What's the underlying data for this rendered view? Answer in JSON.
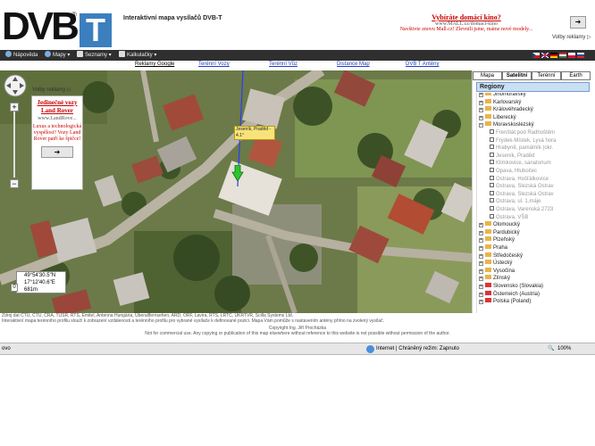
{
  "header": {
    "logo_text": "DVB",
    "logo_mark": "T",
    "logo_reg": "®",
    "app_title": "Interaktivní mapa vysílačů DVB-T",
    "promo": {
      "headline": "Vybíráte domácí kino?",
      "url": "www.MALL.cz/domaci-kino",
      "text": "Navštivte znovu Mall.cz! Zlevnili jsme, máme nové modely...",
      "arrow": "➔",
      "label": "Volby reklamy ▷"
    }
  },
  "menubar": {
    "items": [
      "Nápověda",
      "Mapy ▾",
      "Seznamy ▾",
      "Kalkulačky ▾"
    ]
  },
  "toplinks": [
    "Reklamy Google",
    "Terénní Vozy",
    "Terénní Vůz",
    "Distance Map",
    "DVB T Antény"
  ],
  "map": {
    "ad_label": "Volby reklamy ▷",
    "ad": {
      "title": "Jedinečné vozy Land Rover",
      "url": "www.LandRove...",
      "body": "Luxus a technologická vyspělost? Vozy Land Rover patří ke špičce!",
      "arrow": "➔"
    },
    "marker_label": "Jeseník, Praděd - 4.1°",
    "coords": {
      "lat": "49°54'30.5\"N",
      "lon": "17°12'40.6\"E",
      "alt": "681m"
    },
    "zoom_value": "0"
  },
  "panel": {
    "map_types": [
      "Mapa",
      "Satelitní",
      "Terénní",
      "Earth"
    ],
    "regions_title": "Regiony",
    "regions": [
      {
        "label": "Jihomoravský",
        "kind": "region"
      },
      {
        "label": "Karlovarský",
        "kind": "region"
      },
      {
        "label": "Královéhradecký",
        "kind": "region"
      },
      {
        "label": "Liberecký",
        "kind": "region"
      },
      {
        "label": "Moravskoslezský",
        "kind": "region"
      },
      {
        "label": "Frenštát pod Radhoštěm",
        "kind": "sub"
      },
      {
        "label": "Frýdek-Místek, Lysá hora",
        "kind": "sub"
      },
      {
        "label": "Hrabyně, památník (okr.",
        "kind": "sub"
      },
      {
        "label": "Jeseník, Praděd",
        "kind": "sub"
      },
      {
        "label": "Klimkovice, sanatorium",
        "kind": "sub"
      },
      {
        "label": "Opava, Hlubočec",
        "kind": "sub"
      },
      {
        "label": "Ostrava, Hošťálkovice",
        "kind": "sub"
      },
      {
        "label": "Ostrava, Slezská Ostrav",
        "kind": "sub"
      },
      {
        "label": "Ostrava, Slezská Ostrav",
        "kind": "sub"
      },
      {
        "label": "Ostrava, ul. 1.máje",
        "kind": "sub"
      },
      {
        "label": "Ostrava, Varenská 2723",
        "kind": "sub"
      },
      {
        "label": "Ostrava, VŠB",
        "kind": "sub"
      },
      {
        "label": "Olomoucký",
        "kind": "region"
      },
      {
        "label": "Pardubický",
        "kind": "region"
      },
      {
        "label": "Plzeňský",
        "kind": "region"
      },
      {
        "label": "Praha",
        "kind": "region"
      },
      {
        "label": "Středočeský",
        "kind": "region"
      },
      {
        "label": "Ústecký",
        "kind": "region"
      },
      {
        "label": "Vysočina",
        "kind": "region"
      },
      {
        "label": "Zlínský",
        "kind": "region"
      },
      {
        "label": "Slovensko (Slovakia)",
        "kind": "country"
      },
      {
        "label": "Österreich (Austria)",
        "kind": "country"
      },
      {
        "label": "Polska (Poland)",
        "kind": "country"
      }
    ]
  },
  "attribution": {
    "line1": "Zdroj dat ČTÚ, ČTU, ČRA, TÚSR, RTS, Emitel, Antenna Hungária, Uberallfernsehen, ARD, ORF, Lavira, RTS, LRTC, UKRTVR, Scilla Systems Ltd.",
    "line2": "Interaktivní mapa terénního profilu slouží k zobrazení vzdálenosti a terénního profilu pro vybrané vysílače k definované pozici. Mapa Vám pomůže s nastavením antény přímo na zvolený vysílač."
  },
  "footnote": {
    "line1": "Copyright Ing. Jiří Procházka",
    "line2": "Not for commercial use. Any copying or publication of this map elsewhere without reference to this website is not possible without permission of the author."
  },
  "status": {
    "left": "ovo",
    "zone": "Internet | Chráněný režim: Zapnuto",
    "zoom": "100%"
  }
}
